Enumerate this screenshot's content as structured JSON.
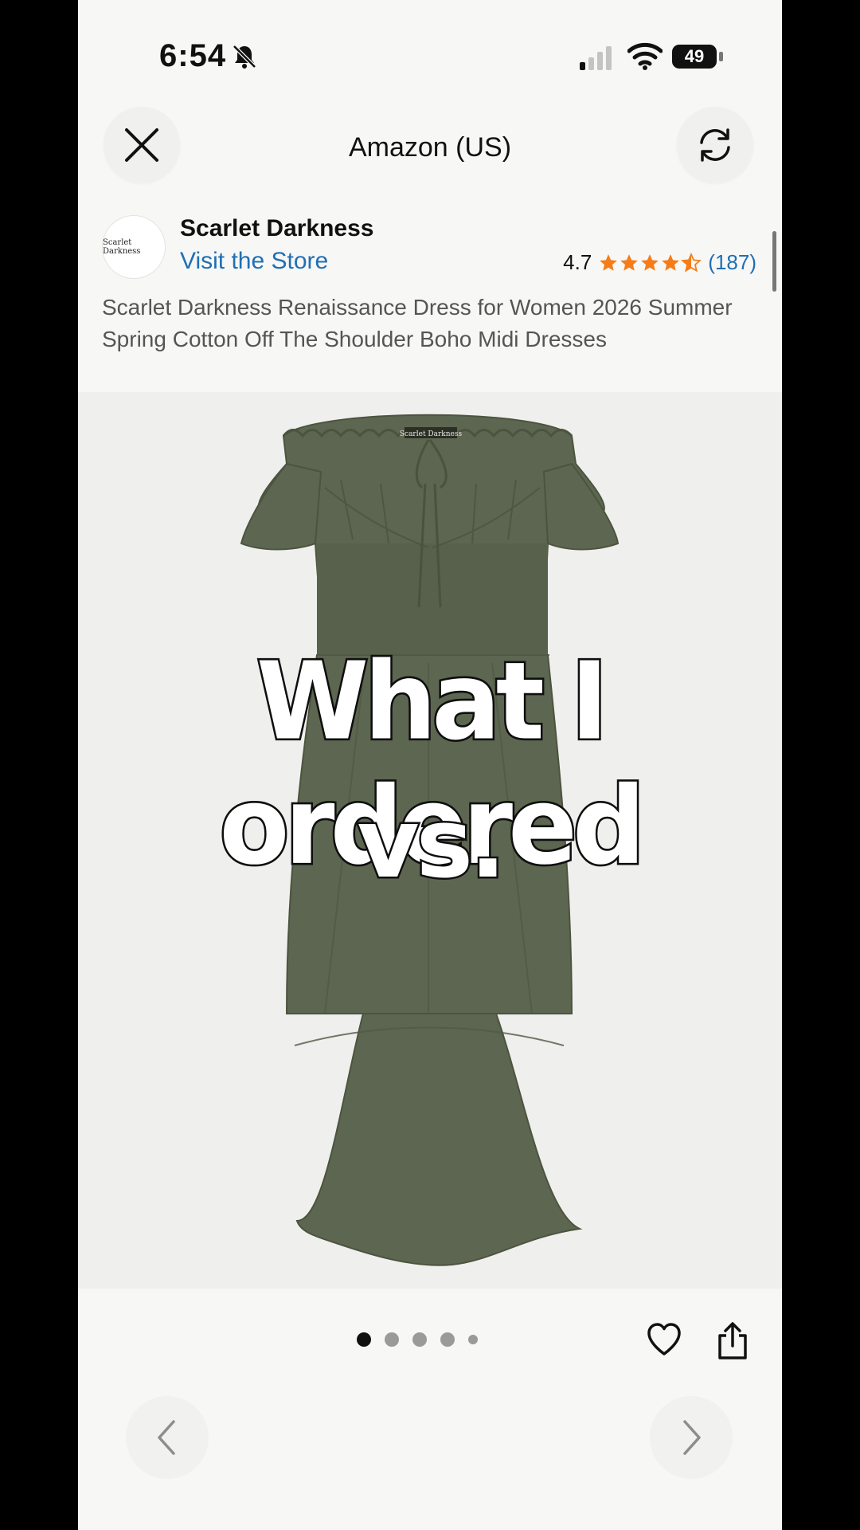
{
  "status_bar": {
    "time": "6:54",
    "battery": "49"
  },
  "header": {
    "title": "Amazon (US)",
    "close_icon": "close-icon",
    "refresh_icon": "refresh-icon"
  },
  "seller": {
    "logo_text": "Scarlet Darkness",
    "name": "Scarlet Darkness",
    "visit_store": "Visit the Store",
    "rating": "4.7",
    "stars": 4.5,
    "review_count": "(187)"
  },
  "product": {
    "title": "Scarlet Darkness Renaissance Dress for Women 2026 Summer Spring Cotton Off The Shoulder Boho Midi Dresses",
    "dress_color": "#5d6650",
    "neck_label": "Scarlet Darkness"
  },
  "overlay": {
    "line1": "What I ordered",
    "line2": "vs."
  },
  "carousel": {
    "total": 5,
    "active": 0
  },
  "colors": {
    "link": "#1f6fb4",
    "star": "#f57c18"
  }
}
